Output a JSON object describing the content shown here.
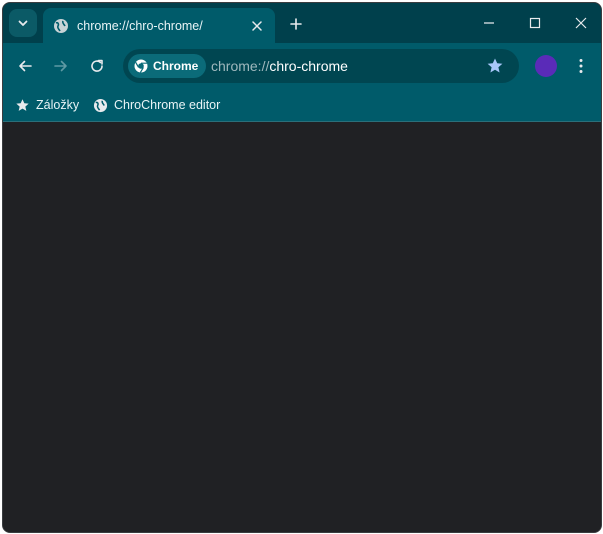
{
  "tab": {
    "title": "chrome://chro-chrome/",
    "favicon": "globe-icon"
  },
  "omnibox": {
    "chip_label": "Chrome",
    "url_scheme": "chrome://",
    "url_host": "chro-chrome"
  },
  "bookmarks": [
    {
      "label": "Záložky",
      "icon": "star-icon"
    },
    {
      "label": "ChroChrome editor",
      "icon": "globe-icon"
    }
  ],
  "colors": {
    "tabstrip": "#00404c",
    "toolbar": "#005b6a",
    "content": "#202124",
    "avatar": "#5a2bb8",
    "star": "#a8c7fa"
  }
}
